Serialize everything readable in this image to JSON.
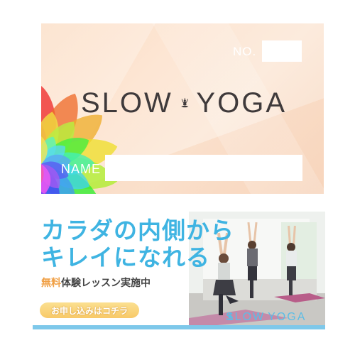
{
  "card": {
    "no_label": "NO.",
    "brand": {
      "left": "SLOW",
      "right": "YOGA"
    },
    "name_label": "NAME"
  },
  "banner": {
    "headline_line1": "カラダの内側から",
    "headline_line2": "キレイになれる",
    "subline_free": "無料",
    "subline_rest": "体験レッスン実施中",
    "cta_label": "お申し込みはコチラ",
    "photo_brand": {
      "left": "SLOW",
      "right": "YOGA"
    }
  },
  "colors": {
    "headline": "#3fb4e2",
    "free_accent": "#f0a046",
    "cta": "#f8c968",
    "accent_line": "#7ec8ea"
  },
  "icons": [
    "meditation-figure-icon",
    "rainbow-flower-graphic"
  ]
}
